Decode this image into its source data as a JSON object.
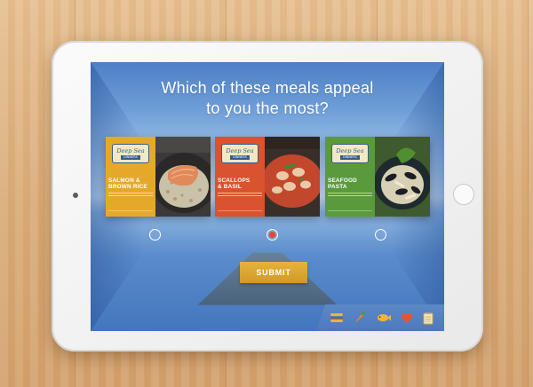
{
  "survey": {
    "question_line1": "Which of these meals appeal",
    "question_line2": "to you the most?"
  },
  "brand": {
    "name": "Deep Sea",
    "subtitle": "DINNERS"
  },
  "meals": [
    {
      "title_line1": "SALMON &",
      "title_line2": "BROWN RICE",
      "panel_color": "#e5a92a",
      "selected": false
    },
    {
      "title_line1": "SCALLOPS",
      "title_line2": "& BASIL",
      "panel_color": "#d9532e",
      "selected": true
    },
    {
      "title_line1": "SEAFOOD",
      "title_line2": "PASTA",
      "panel_color": "#5a9a3d",
      "selected": false
    }
  ],
  "actions": {
    "submit_label": "SUBMIT"
  },
  "nav_icons": [
    "sandwich-icon",
    "carrot-icon",
    "fish-icon",
    "heart-icon",
    "clipboard-icon"
  ],
  "colors": {
    "accent_submit": "#dba52d",
    "selected_radio": "#e8452b"
  }
}
